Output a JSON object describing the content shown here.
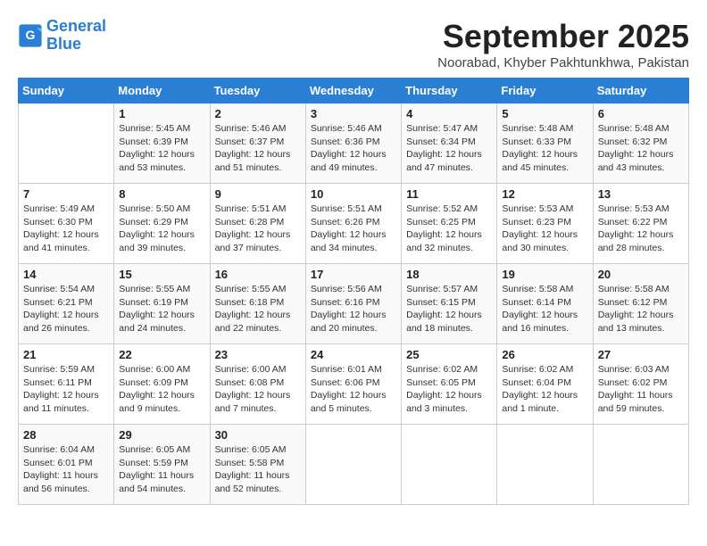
{
  "header": {
    "logo_line1": "General",
    "logo_line2": "Blue",
    "month": "September 2025",
    "location": "Noorabad, Khyber Pakhtunkhwa, Pakistan"
  },
  "weekdays": [
    "Sunday",
    "Monday",
    "Tuesday",
    "Wednesday",
    "Thursday",
    "Friday",
    "Saturday"
  ],
  "weeks": [
    [
      {
        "day": "",
        "sunrise": "",
        "sunset": "",
        "daylight": ""
      },
      {
        "day": "1",
        "sunrise": "Sunrise: 5:45 AM",
        "sunset": "Sunset: 6:39 PM",
        "daylight": "Daylight: 12 hours and 53 minutes."
      },
      {
        "day": "2",
        "sunrise": "Sunrise: 5:46 AM",
        "sunset": "Sunset: 6:37 PM",
        "daylight": "Daylight: 12 hours and 51 minutes."
      },
      {
        "day": "3",
        "sunrise": "Sunrise: 5:46 AM",
        "sunset": "Sunset: 6:36 PM",
        "daylight": "Daylight: 12 hours and 49 minutes."
      },
      {
        "day": "4",
        "sunrise": "Sunrise: 5:47 AM",
        "sunset": "Sunset: 6:34 PM",
        "daylight": "Daylight: 12 hours and 47 minutes."
      },
      {
        "day": "5",
        "sunrise": "Sunrise: 5:48 AM",
        "sunset": "Sunset: 6:33 PM",
        "daylight": "Daylight: 12 hours and 45 minutes."
      },
      {
        "day": "6",
        "sunrise": "Sunrise: 5:48 AM",
        "sunset": "Sunset: 6:32 PM",
        "daylight": "Daylight: 12 hours and 43 minutes."
      }
    ],
    [
      {
        "day": "7",
        "sunrise": "Sunrise: 5:49 AM",
        "sunset": "Sunset: 6:30 PM",
        "daylight": "Daylight: 12 hours and 41 minutes."
      },
      {
        "day": "8",
        "sunrise": "Sunrise: 5:50 AM",
        "sunset": "Sunset: 6:29 PM",
        "daylight": "Daylight: 12 hours and 39 minutes."
      },
      {
        "day": "9",
        "sunrise": "Sunrise: 5:51 AM",
        "sunset": "Sunset: 6:28 PM",
        "daylight": "Daylight: 12 hours and 37 minutes."
      },
      {
        "day": "10",
        "sunrise": "Sunrise: 5:51 AM",
        "sunset": "Sunset: 6:26 PM",
        "daylight": "Daylight: 12 hours and 34 minutes."
      },
      {
        "day": "11",
        "sunrise": "Sunrise: 5:52 AM",
        "sunset": "Sunset: 6:25 PM",
        "daylight": "Daylight: 12 hours and 32 minutes."
      },
      {
        "day": "12",
        "sunrise": "Sunrise: 5:53 AM",
        "sunset": "Sunset: 6:23 PM",
        "daylight": "Daylight: 12 hours and 30 minutes."
      },
      {
        "day": "13",
        "sunrise": "Sunrise: 5:53 AM",
        "sunset": "Sunset: 6:22 PM",
        "daylight": "Daylight: 12 hours and 28 minutes."
      }
    ],
    [
      {
        "day": "14",
        "sunrise": "Sunrise: 5:54 AM",
        "sunset": "Sunset: 6:21 PM",
        "daylight": "Daylight: 12 hours and 26 minutes."
      },
      {
        "day": "15",
        "sunrise": "Sunrise: 5:55 AM",
        "sunset": "Sunset: 6:19 PM",
        "daylight": "Daylight: 12 hours and 24 minutes."
      },
      {
        "day": "16",
        "sunrise": "Sunrise: 5:55 AM",
        "sunset": "Sunset: 6:18 PM",
        "daylight": "Daylight: 12 hours and 22 minutes."
      },
      {
        "day": "17",
        "sunrise": "Sunrise: 5:56 AM",
        "sunset": "Sunset: 6:16 PM",
        "daylight": "Daylight: 12 hours and 20 minutes."
      },
      {
        "day": "18",
        "sunrise": "Sunrise: 5:57 AM",
        "sunset": "Sunset: 6:15 PM",
        "daylight": "Daylight: 12 hours and 18 minutes."
      },
      {
        "day": "19",
        "sunrise": "Sunrise: 5:58 AM",
        "sunset": "Sunset: 6:14 PM",
        "daylight": "Daylight: 12 hours and 16 minutes."
      },
      {
        "day": "20",
        "sunrise": "Sunrise: 5:58 AM",
        "sunset": "Sunset: 6:12 PM",
        "daylight": "Daylight: 12 hours and 13 minutes."
      }
    ],
    [
      {
        "day": "21",
        "sunrise": "Sunrise: 5:59 AM",
        "sunset": "Sunset: 6:11 PM",
        "daylight": "Daylight: 12 hours and 11 minutes."
      },
      {
        "day": "22",
        "sunrise": "Sunrise: 6:00 AM",
        "sunset": "Sunset: 6:09 PM",
        "daylight": "Daylight: 12 hours and 9 minutes."
      },
      {
        "day": "23",
        "sunrise": "Sunrise: 6:00 AM",
        "sunset": "Sunset: 6:08 PM",
        "daylight": "Daylight: 12 hours and 7 minutes."
      },
      {
        "day": "24",
        "sunrise": "Sunrise: 6:01 AM",
        "sunset": "Sunset: 6:06 PM",
        "daylight": "Daylight: 12 hours and 5 minutes."
      },
      {
        "day": "25",
        "sunrise": "Sunrise: 6:02 AM",
        "sunset": "Sunset: 6:05 PM",
        "daylight": "Daylight: 12 hours and 3 minutes."
      },
      {
        "day": "26",
        "sunrise": "Sunrise: 6:02 AM",
        "sunset": "Sunset: 6:04 PM",
        "daylight": "Daylight: 12 hours and 1 minute."
      },
      {
        "day": "27",
        "sunrise": "Sunrise: 6:03 AM",
        "sunset": "Sunset: 6:02 PM",
        "daylight": "Daylight: 11 hours and 59 minutes."
      }
    ],
    [
      {
        "day": "28",
        "sunrise": "Sunrise: 6:04 AM",
        "sunset": "Sunset: 6:01 PM",
        "daylight": "Daylight: 11 hours and 56 minutes."
      },
      {
        "day": "29",
        "sunrise": "Sunrise: 6:05 AM",
        "sunset": "Sunset: 5:59 PM",
        "daylight": "Daylight: 11 hours and 54 minutes."
      },
      {
        "day": "30",
        "sunrise": "Sunrise: 6:05 AM",
        "sunset": "Sunset: 5:58 PM",
        "daylight": "Daylight: 11 hours and 52 minutes."
      },
      {
        "day": "",
        "sunrise": "",
        "sunset": "",
        "daylight": ""
      },
      {
        "day": "",
        "sunrise": "",
        "sunset": "",
        "daylight": ""
      },
      {
        "day": "",
        "sunrise": "",
        "sunset": "",
        "daylight": ""
      },
      {
        "day": "",
        "sunrise": "",
        "sunset": "",
        "daylight": ""
      }
    ]
  ]
}
